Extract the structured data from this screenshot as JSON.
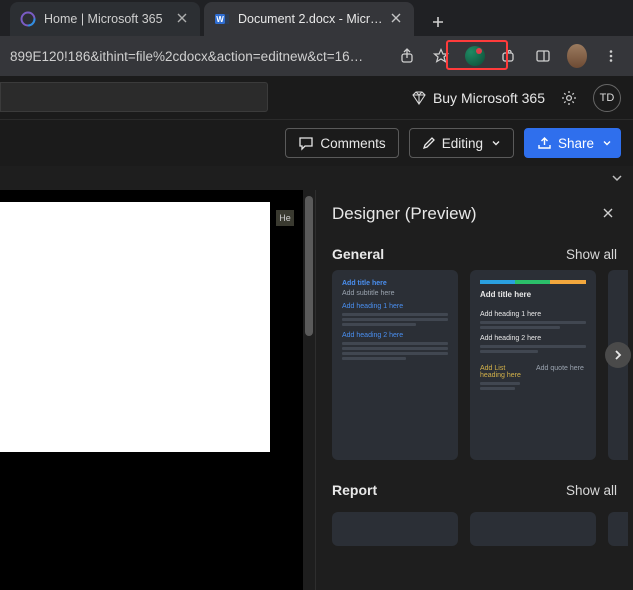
{
  "browser": {
    "tabs": [
      {
        "title": "Home | Microsoft 365"
      },
      {
        "title": "Document 2.docx - Microsoft W"
      }
    ],
    "url_fragment": "899E120!186&ithint=file%2cdocx&action=editnew&ct=16…"
  },
  "app": {
    "buy_label": "Buy Microsoft 365",
    "account_initials": "TD"
  },
  "toolbar": {
    "comments_label": "Comments",
    "editing_label": "Editing",
    "share_label": "Share"
  },
  "doc": {
    "hit_label": "He"
  },
  "designer": {
    "title": "Designer (Preview)",
    "sections": {
      "general": {
        "name": "General",
        "show_all": "Show all"
      },
      "report": {
        "name": "Report",
        "show_all": "Show all"
      }
    },
    "templates": {
      "general": [
        {
          "title": "Add title here",
          "subtitle": "Add subtitle here",
          "h1": "Add heading 1 here",
          "h2": "Add heading 2 here"
        },
        {
          "title": "Add title here",
          "h1": "Add heading 1 here",
          "h2": "Add heading 2 here",
          "list": "Add List heading here",
          "quote": "Add quote here"
        }
      ]
    }
  }
}
